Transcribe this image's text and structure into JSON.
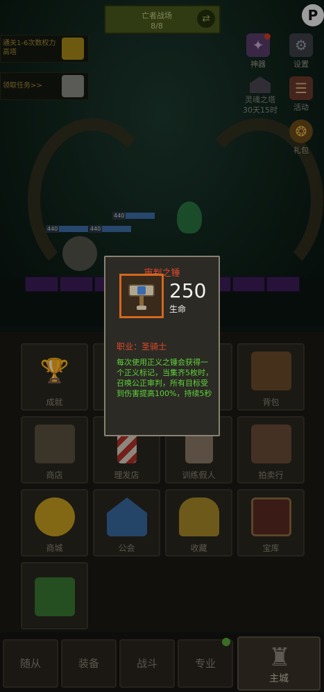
{
  "top_banner": {
    "title": "亡者战场",
    "progress": "8/8"
  },
  "quests": [
    {
      "text": "通关1-6次数权力高塔"
    },
    {
      "text": "领取任务>>"
    }
  ],
  "side_menu": {
    "artifact": "神器",
    "settings": "设置",
    "soul_tower": "灵魂之塔",
    "soul_tower_timer": "30天15时",
    "activity": "活动",
    "gift": "礼包"
  },
  "units": [
    {
      "hp": "440"
    },
    {
      "hp": "440"
    },
    {
      "hp": "440"
    }
  ],
  "tooltip": {
    "title": "审判之锤",
    "stat_value": "250",
    "stat_label": "生命",
    "class_line": "职业：圣骑士",
    "description": "每次使用正义之锤会获得一个正义标记，当集齐5枚时，召唤公正审判，所有目标受到伤害提高100%，持续5秒"
  },
  "grid": [
    {
      "label": "成就",
      "icon": "trophy-icon"
    },
    {
      "label": "",
      "icon": "hidden-icon"
    },
    {
      "label": "",
      "icon": "hidden-icon"
    },
    {
      "label": "背包",
      "icon": "backpack-icon"
    },
    {
      "label": "商店",
      "icon": "chest-icon"
    },
    {
      "label": "理发店",
      "icon": "barber-pole-icon"
    },
    {
      "label": "训练假人",
      "icon": "dummy-icon"
    },
    {
      "label": "拍卖行",
      "icon": "gavel-icon"
    },
    {
      "label": "商城",
      "icon": "coin-icon"
    },
    {
      "label": "公会",
      "icon": "guild-hall-icon"
    },
    {
      "label": "收藏",
      "icon": "helmet-icon"
    },
    {
      "label": "宝库",
      "icon": "vault-icon"
    },
    {
      "label": "",
      "icon": "dragon-icon"
    }
  ],
  "bottom_nav": {
    "tabs": [
      "随从",
      "装备",
      "战斗",
      "专业"
    ],
    "home": "主城"
  },
  "colors": {
    "rarity_orange": "#d2681e",
    "title_red": "#e24a2a",
    "desc_green": "#5ed23a"
  }
}
